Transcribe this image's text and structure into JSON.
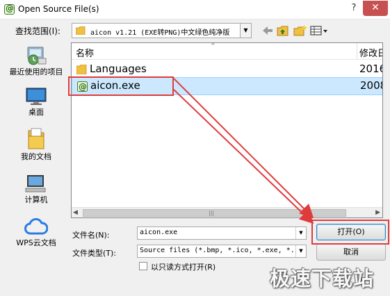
{
  "window": {
    "title": "Open Source File(s)",
    "help_label": "?",
    "close_label": "✕"
  },
  "lookin": {
    "label": "查找范围(I):",
    "value": "aicon v1.21 (EXE转PNG)中文绿色纯净版"
  },
  "toolbar": {
    "back_icon": "back-arrow-icon",
    "up_icon": "up-folder-icon",
    "new_folder_icon": "new-folder-icon",
    "view_menu_icon": "view-menu-icon"
  },
  "places": [
    {
      "label": "最近使用的项目",
      "icon": "recent-places-icon"
    },
    {
      "label": "桌面",
      "icon": "desktop-icon"
    },
    {
      "label": "我的文档",
      "icon": "documents-icon"
    },
    {
      "label": "计算机",
      "icon": "computer-icon"
    },
    {
      "label": "WPS云文档",
      "icon": "cloud-icon"
    }
  ],
  "columns": {
    "name": "名称",
    "date": "修改日"
  },
  "files": [
    {
      "name": "Languages",
      "date": "2016",
      "type": "folder"
    },
    {
      "name": "aicon.exe",
      "date": "2008",
      "type": "exe",
      "selected": true
    }
  ],
  "filename": {
    "label": "文件名(N):",
    "value": "aicon.exe"
  },
  "filetype": {
    "label": "文件类型(T):",
    "value": "Source files (*.bmp, *.ico, *.exe, *."
  },
  "readonly": {
    "label": "以只读方式打开(R)",
    "checked": false
  },
  "buttons": {
    "open": "打开(O)",
    "cancel": "取消"
  },
  "watermark": "极速下载站",
  "colors": {
    "annotation": "#e03b3b",
    "selection": "#cce8ff",
    "close": "#c75050"
  }
}
